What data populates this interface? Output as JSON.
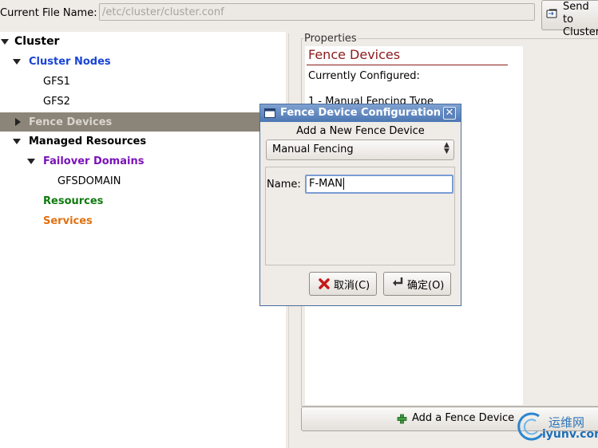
{
  "toolbar": {
    "file_label": "Current File Name:",
    "file_path": "/etc/cluster/cluster.conf",
    "send_button_line1": "Send to",
    "send_button_line2": "Cluster"
  },
  "tree": {
    "root": "Cluster",
    "cluster_nodes": "Cluster Nodes",
    "node1": "GFS1",
    "node2": "GFS2",
    "fence_devices": "Fence Devices",
    "managed_resources": "Managed Resources",
    "failover_domains": "Failover Domains",
    "gfsdomain": "GFSDOMAIN",
    "resources": "Resources",
    "services": "Services",
    "colors": {
      "cluster_nodes": "#1a44d6",
      "failover_domains": "#7a13b8",
      "resources": "#0f7a0f",
      "services": "#e07010",
      "selected_bg": "#8b8478"
    }
  },
  "properties": {
    "frame_label": "Properties",
    "title": "Fence Devices",
    "currently_configured": "Currently Configured:",
    "item_1": "1 - Manual Fencing Type",
    "add_button": "Add a Fence Device"
  },
  "dialog": {
    "title": "Fence Device Configuration",
    "heading": "Add a New Fence Device",
    "device_type": "Manual Fencing",
    "name_label": "Name:",
    "name_value": "F-MAN",
    "cancel_label": "取消(C)",
    "ok_label": "确定(O)"
  },
  "watermark": {
    "top": "运维网",
    "bottom": "iyunv.com"
  }
}
